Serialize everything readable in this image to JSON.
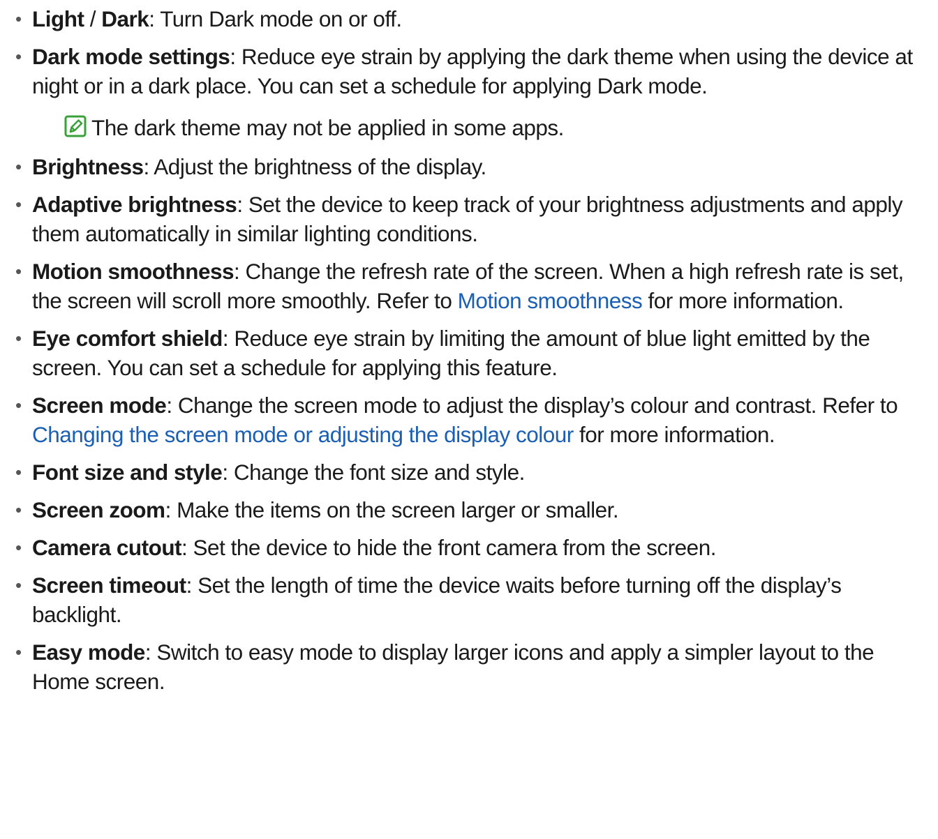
{
  "items": [
    {
      "term_a": "Light",
      "sep": " / ",
      "term_b": "Dark",
      "desc": ": Turn Dark mode on or off."
    },
    {
      "term": "Dark mode settings",
      "desc": ": Reduce eye strain by applying the dark theme when using the device at night or in a dark place. You can set a schedule for applying Dark mode.",
      "note": "The dark theme may not be applied in some apps.",
      "note_icon": "note-icon"
    },
    {
      "term": "Brightness",
      "desc": ": Adjust the brightness of the display."
    },
    {
      "term": "Adaptive brightness",
      "desc": ": Set the device to keep track of your brightness adjustments and apply them automatically in similar lighting conditions."
    },
    {
      "term": "Motion smoothness",
      "desc_before": ": Change the refresh rate of the screen. When a high refresh rate is set, the screen will scroll more smoothly. Refer to ",
      "link": "Motion smoothness",
      "desc_after": " for more information."
    },
    {
      "term": "Eye comfort shield",
      "desc": ": Reduce eye strain by limiting the amount of blue light emitted by the screen. You can set a schedule for applying this feature."
    },
    {
      "term": "Screen mode",
      "desc_before": ": Change the screen mode to adjust the display’s colour and contrast. Refer to ",
      "link": "Changing the screen mode or adjusting the display colour",
      "desc_after": " for more information."
    },
    {
      "term": "Font size and style",
      "desc": ": Change the font size and style."
    },
    {
      "term": "Screen zoom",
      "desc": ": Make the items on the screen larger or smaller."
    },
    {
      "term": "Camera cutout",
      "desc": ": Set the device to hide the front camera from the screen."
    },
    {
      "term": "Screen timeout",
      "desc": ": Set the length of time the device waits before turning off the display’s backlight."
    },
    {
      "term": "Easy mode",
      "desc": ": Switch to easy mode to display larger icons and apply a simpler layout to the Home screen."
    }
  ],
  "colors": {
    "text": "#1a1a1a",
    "link": "#1a5fb4",
    "note_icon": "#3aa13a"
  }
}
